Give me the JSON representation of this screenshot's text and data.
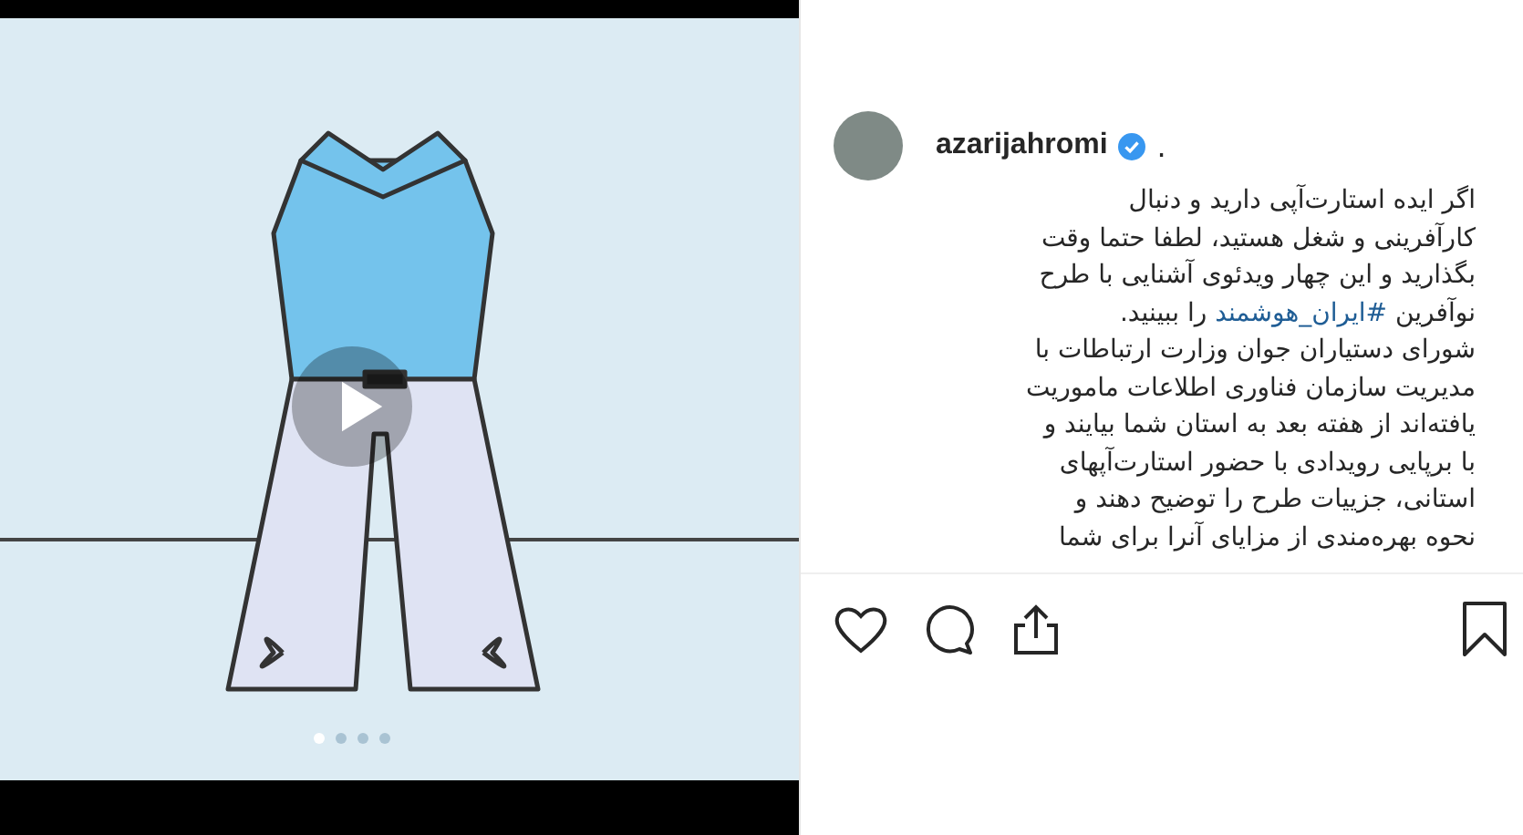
{
  "video": {
    "slides": [
      {
        "selected": true
      },
      {
        "selected": false
      },
      {
        "selected": false
      },
      {
        "selected": false
      }
    ]
  },
  "post": {
    "username": "azarijahromi",
    "verified": true,
    "separator": ".",
    "caption": [
      [
        {
          "kind": "plain",
          "text": "اگر ایده استارت‌آپی دارید و دنبال"
        }
      ],
      [
        {
          "kind": "plain",
          "text": "کارآفرینی و شغل هستید، لطفا حتما وقت"
        }
      ],
      [
        {
          "kind": "plain",
          "text": "بگذارید و این چهار ویدئوی آشنایی با طرح"
        }
      ],
      [
        {
          "kind": "plain",
          "text": "نوآفرین "
        },
        {
          "kind": "hashtag",
          "text": "#ایران_هوشمند"
        },
        {
          "kind": "plain",
          "text": " را ببینید."
        }
      ],
      [
        {
          "kind": "plain",
          "text": "شورای دستیاران جوان وزارت ارتباطات با"
        }
      ],
      [
        {
          "kind": "plain",
          "text": "مدیریت سازمان فناوری اطلاعات ماموریت"
        }
      ],
      [
        {
          "kind": "plain",
          "text": "یافته‌اند از هفته بعد به استان شما بیایند و"
        }
      ],
      [
        {
          "kind": "plain",
          "text": "با برپایی رویدادی با حضور استارت‌آپهای"
        }
      ],
      [
        {
          "kind": "plain",
          "text": "استانی، جزییات طرح را توضیح دهند و"
        }
      ],
      [
        {
          "kind": "plain",
          "text": "نحوه بهره‌مندی از مزایای آنرا برای شما"
        }
      ]
    ]
  }
}
